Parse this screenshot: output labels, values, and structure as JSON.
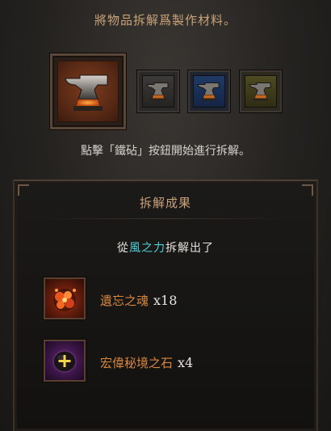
{
  "header": {
    "text": "將物品拆解爲製作材料。"
  },
  "slots": {
    "main": {
      "icon": "anvil-icon"
    },
    "options": [
      {
        "icon": "anvil-icon",
        "tier": "gray"
      },
      {
        "icon": "anvil-icon",
        "tier": "blue"
      },
      {
        "icon": "anvil-icon",
        "tier": "gold"
      }
    ]
  },
  "instruction": "點擊「鐵砧」按鈕開始進行拆解。",
  "results": {
    "title": "拆解成果",
    "extracted_prefix": "從",
    "extracted_item": "風之力",
    "extracted_suffix": "拆解出了",
    "items": [
      {
        "name": "遺忘之魂",
        "qty": "x18",
        "icon": "forgotten-soul-icon"
      },
      {
        "name": "宏偉秘境之石",
        "qty": "x4",
        "icon": "greater-rift-stone-icon"
      }
    ]
  },
  "colors": {
    "accent_gold": "#c9a27a",
    "item_orange": "#d9863f",
    "legendary_cyan": "#4fd0d8"
  }
}
